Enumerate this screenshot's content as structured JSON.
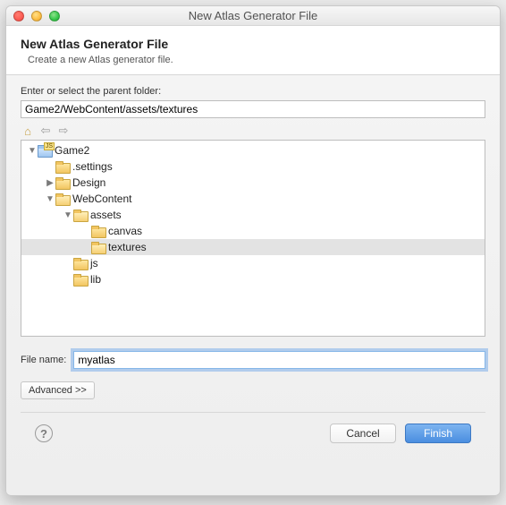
{
  "window": {
    "title": "New Atlas Generator File"
  },
  "header": {
    "heading": "New Atlas Generator File",
    "description": "Create a new Atlas generator file."
  },
  "parent": {
    "label": "Enter or select the parent folder:",
    "path": "Game2/WebContent/assets/textures"
  },
  "tree": {
    "root": {
      "name": "Game2",
      "children": [
        {
          "name": ".settings",
          "expanded": false,
          "hasArrow": false
        },
        {
          "name": "Design",
          "expanded": false,
          "hasArrow": true
        },
        {
          "name": "WebContent",
          "expanded": true,
          "hasArrow": true,
          "children": [
            {
              "name": "assets",
              "expanded": true,
              "hasArrow": true,
              "children": [
                {
                  "name": "canvas",
                  "expanded": false,
                  "hasArrow": false
                },
                {
                  "name": "textures",
                  "expanded": false,
                  "hasArrow": false,
                  "selected": true
                }
              ]
            },
            {
              "name": "js",
              "expanded": false,
              "hasArrow": false
            },
            {
              "name": "lib",
              "expanded": false,
              "hasArrow": false
            }
          ]
        }
      ]
    }
  },
  "filename": {
    "label": "File name:",
    "value": "myatlas"
  },
  "buttons": {
    "advanced": "Advanced >>",
    "cancel": "Cancel",
    "finish": "Finish"
  }
}
